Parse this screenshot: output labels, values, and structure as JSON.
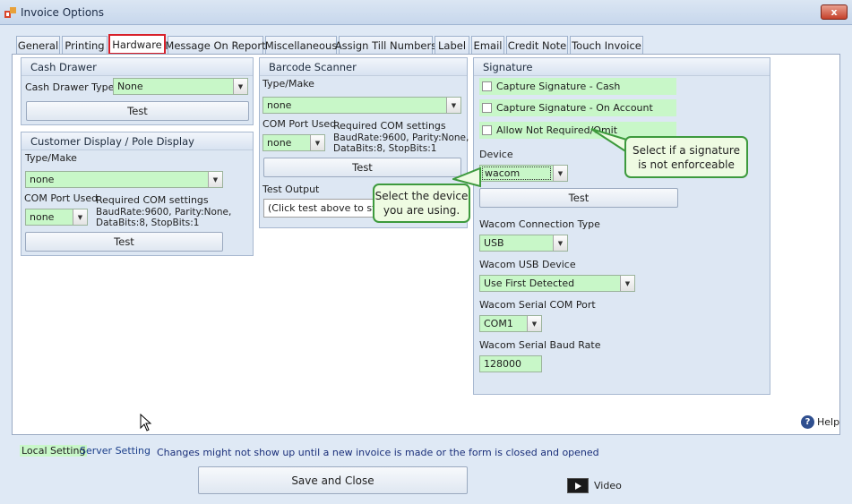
{
  "window": {
    "title": "Invoice Options",
    "close_label": "x"
  },
  "tabs": [
    {
      "label": "General",
      "active": false
    },
    {
      "label": "Printing",
      "active": false
    },
    {
      "label": "Hardware",
      "active": true
    },
    {
      "label": "Message On Report",
      "active": false
    },
    {
      "label": "Miscellaneous",
      "active": false
    },
    {
      "label": "Assign Till Numbers",
      "active": false
    },
    {
      "label": "Label",
      "active": false
    },
    {
      "label": "Email",
      "active": false
    },
    {
      "label": "Credit Note",
      "active": false
    },
    {
      "label": "Touch Invoice",
      "active": false
    }
  ],
  "cash_drawer": {
    "title": "Cash Drawer",
    "type_label": "Cash Drawer Type",
    "type_value": "None",
    "test_label": "Test"
  },
  "customer_display": {
    "title": "Customer Display / Pole Display",
    "type_label": "Type/Make",
    "type_value": "none",
    "com_port_label": "COM Port Used",
    "com_port_value": "none",
    "req_title": "Required COM settings",
    "req_line1": "BaudRate:9600, Parity:None,",
    "req_line2": "DataBits:8, StopBits:1",
    "test_label": "Test"
  },
  "barcode_scanner": {
    "title": "Barcode Scanner",
    "type_label": "Type/Make",
    "type_value": "none",
    "com_port_label": "COM Port Used",
    "com_port_value": "none",
    "req_title": "Required COM settings",
    "req_line1": "BaudRate:9600, Parity:None,",
    "req_line2": "DataBits:8, StopBits:1",
    "test_label": "Test",
    "test_output_label": "Test Output",
    "test_output_value": "(Click test above to start)"
  },
  "signature": {
    "title": "Signature",
    "capture_cash": "Capture Signature - Cash",
    "capture_account": "Capture Signature - On Account",
    "allow_not_required": "Allow Not Required/Omit",
    "device_label": "Device",
    "device_value": "wacom",
    "test_label": "Test",
    "conn_type_label": "Wacom Connection Type",
    "conn_type_value": "USB",
    "usb_device_label": "Wacom USB Device",
    "usb_device_value": "Use First Detected",
    "serial_port_label": "Wacom Serial COM Port",
    "serial_port_value": "COM1",
    "baud_rate_label": "Wacom Serial Baud Rate",
    "baud_rate_value": "128000"
  },
  "callouts": {
    "device": "Select the device you are using.",
    "signature_line1": "Select if a signature",
    "signature_line2": "is not enforceable"
  },
  "help": {
    "label": "Help"
  },
  "status": {
    "local_setting": "Local Setting",
    "server_setting": "Server Setting",
    "notice": "Changes might not show up until a new invoice is made or the form is closed and opened"
  },
  "footer": {
    "save_label": "Save and Close",
    "video_label": "Video"
  },
  "colors": {
    "local_setting_bg": "#c8f7c8",
    "server_setting_text": "#1a3e8a",
    "notice_text": "#1a2f7a",
    "active_tab_border": "#d8202a",
    "callout_border": "#3d9a3d"
  }
}
